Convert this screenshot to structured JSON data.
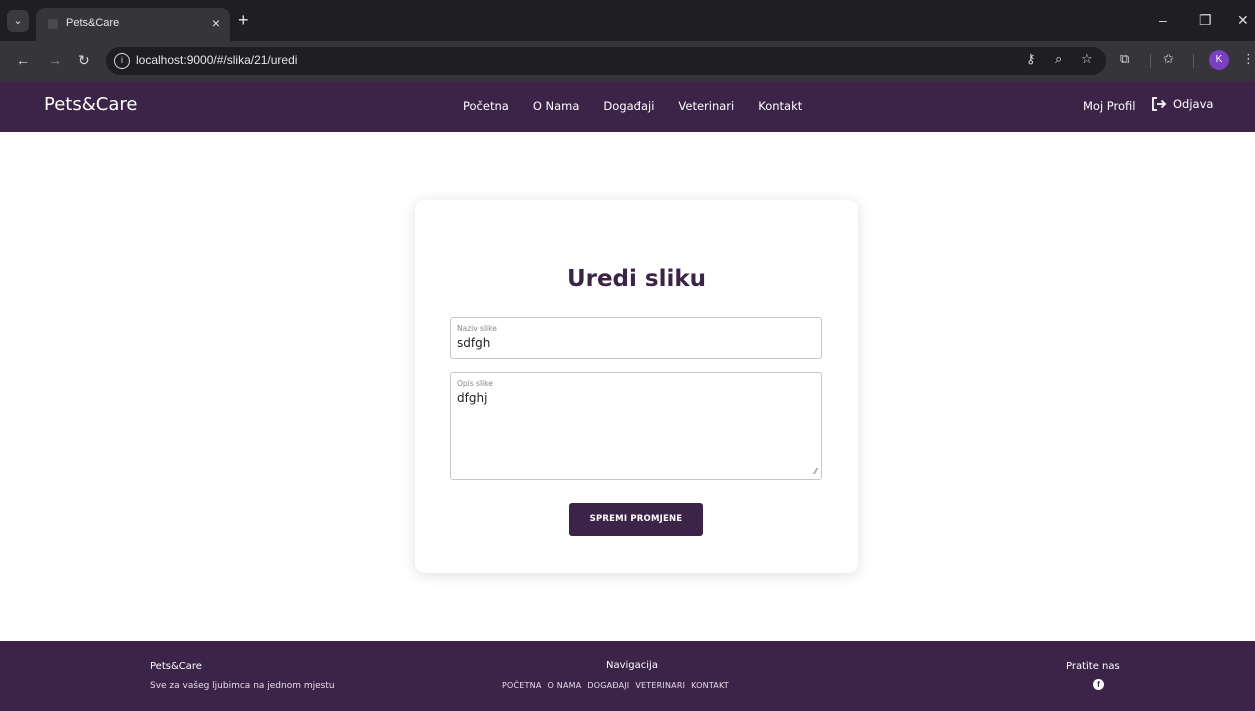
{
  "browser": {
    "tab_title": "Pets&Care",
    "tab_close": "×",
    "new_tab": "+",
    "url": "localhost:9000/#/slika/21/uredi",
    "profile_initial": "K",
    "window_controls": {
      "minimize": "–",
      "restore": "❐",
      "close": "✕"
    }
  },
  "site": {
    "brand": "Pets&Care",
    "nav": [
      "Početna",
      "O Nama",
      "Događaji",
      "Veterinari",
      "Kontakt"
    ],
    "profile_link": "Moj Profil",
    "logout_label": "Odjava"
  },
  "form": {
    "title": "Uredi sliku",
    "name_label": "Naziv slike",
    "name_value": "sdfgh",
    "description_label": "Opis slike",
    "description_value": "dfghj",
    "submit_label": "SPREMI PROMJENE"
  },
  "footer": {
    "brand": "Pets&Care",
    "tagline": "Sve za vašeg ljubimca na jednom mjestu",
    "nav_title": "Navigacija",
    "nav": [
      "POČETNA",
      "O NAMA",
      "DOGAĐAJI",
      "VETERINARI",
      "KONTAKT"
    ],
    "follow_title": "Pratite nas"
  },
  "icons": {
    "tab_search": "chevron-down-icon",
    "back": "arrow-left-icon",
    "forward": "arrow-right-icon",
    "reload": "reload-icon",
    "site_info": "info-icon",
    "password": "key-icon",
    "zoom": "zoom-icon",
    "bookmark": "star-icon",
    "extensions": "puzzle-icon",
    "bookmarks": "bookmarks-icon",
    "menu": "kebab-menu-icon",
    "logout": "logout-icon",
    "facebook": "facebook-icon"
  },
  "colors": {
    "brand_purple": "#3c2448",
    "page_background": "#ffffff",
    "browser_dark": "#1f1f22"
  }
}
